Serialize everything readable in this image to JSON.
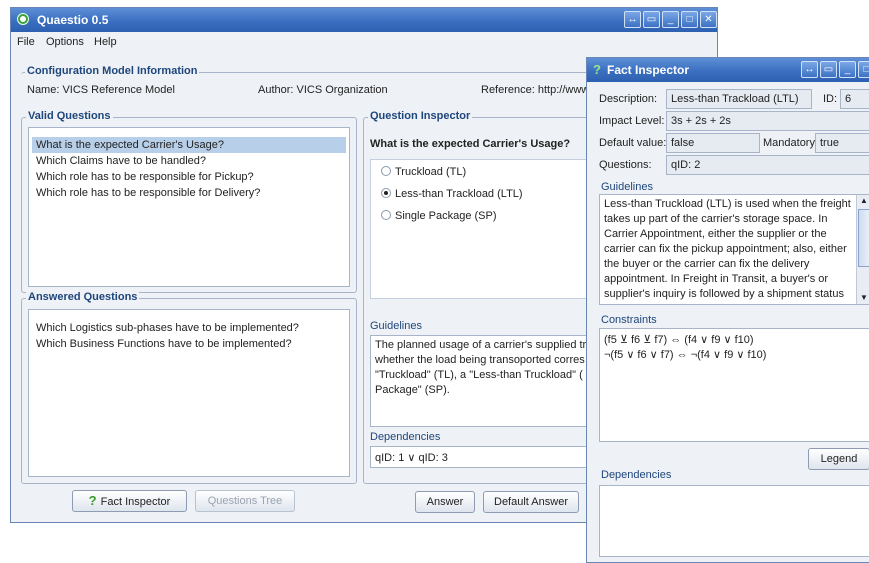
{
  "main_window": {
    "title": "Quaestio 0.5",
    "menu": [
      "File",
      "Options",
      "Help"
    ],
    "config": {
      "section_title": "Configuration Model Information",
      "name": "Name: VICS Reference Model",
      "author": "Author: VICS Organization",
      "reference": "Reference: http://www"
    },
    "valid_questions": {
      "title": "Valid Questions",
      "items": [
        "What is the expected Carrier's Usage?",
        "Which Claims have to be handled?",
        "Which role has to be responsible for Pickup?",
        "Which role has to be responsible for Delivery?"
      ]
    },
    "answered_questions": {
      "title": "Answered Questions",
      "items": [
        "Which Logistics sub-phases have to be implemented?",
        "Which Business Functions have to be implemented?"
      ]
    },
    "question_inspector": {
      "title": "Question Inspector",
      "question": "What is the expected Carrier's Usage?",
      "options": [
        "Truckload (TL)",
        "Less-than Trackload (LTL)",
        "Single Package (SP)"
      ],
      "selected_index": 1,
      "guidelines_label": "Guidelines",
      "guidelines_text": "The planned usage of a carrier's supplied tr whether the load being transoported corres \"Truckload\" (TL), a \"Less-than Truckload\" ( Package\" (SP).",
      "dependencies_label": "Dependencies",
      "dependencies_value": "qID: 1 ∨ qID: 3"
    },
    "buttons": {
      "fact_inspector": "Fact Inspector",
      "questions_tree": "Questions Tree",
      "answer": "Answer",
      "default_answer": "Default Answer"
    }
  },
  "fact_inspector": {
    "title": "Fact Inspector",
    "description_label": "Description:",
    "description_value": "Less-than Trackload (LTL)",
    "id_label": "ID:",
    "id_value": "6",
    "impact_label": "Impact Level:",
    "impact_value": "3s + 2s + 2s",
    "default_label": "Default value:",
    "default_value": "false",
    "mandatory_label": "Mandatory:",
    "mandatory_value": "true",
    "questions_label": "Questions:",
    "questions_value": "qID: 2",
    "guidelines_label": "Guidelines",
    "guidelines_text": "Less-than Truckload (LTL) is used when the freight takes up part of the carrier's storage space. In Carrier Appointment, either the supplier or the carrier can fix the pickup appointment; also, either the buyer or the carrier can fix the delivery appointment. In Freight in Transit, a buyer's or supplier's inquiry is followed by a shipment status",
    "constraints_label": "Constraints",
    "constraints": [
      "(f5 ⊻ f6 ⊻ f7) ⇔ (f4 ∨ f9 ∨ f10)",
      "¬(f5 ∨ f6 ∨ f7) ⇔ ¬(f4 ∨ f9 ∨ f10)"
    ],
    "legend_button": "Legend",
    "dependencies_label": "Dependencies"
  }
}
